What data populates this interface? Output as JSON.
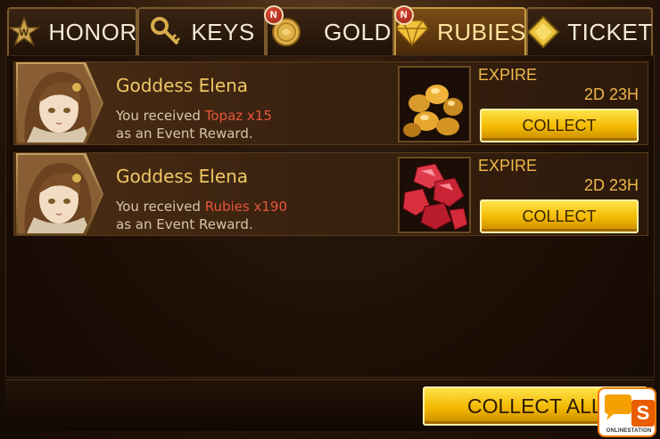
{
  "tabs": [
    {
      "label": "HONOR",
      "icon": "star-wreath-icon",
      "active": false,
      "badge": ""
    },
    {
      "label": "KEYS",
      "icon": "key-icon",
      "active": false,
      "badge": ""
    },
    {
      "label": "GOLD",
      "icon": "gold-coin-icon",
      "active": false,
      "badge": "N"
    },
    {
      "label": "RUBIES",
      "icon": "ruby-gem-icon",
      "active": true,
      "badge": "N"
    },
    {
      "label": "TICKET",
      "icon": "ticket-diamond-icon",
      "active": false,
      "badge": ""
    }
  ],
  "mails": [
    {
      "sender": "Goddess Elena",
      "prefix": "You received",
      "item": "Topaz x15",
      "suffix": "as an Event Reward.",
      "item_icon": "topaz-pile-icon",
      "expire_label": "EXPIRE",
      "expire_time": "2D 23H",
      "collect_label": "COLLECT"
    },
    {
      "sender": "Goddess Elena",
      "prefix": "You received",
      "item": "Rubies x190",
      "suffix": "as an Event Reward.",
      "item_icon": "rubies-pile-icon",
      "expire_label": "EXPIRE",
      "expire_time": "2D 23H",
      "collect_label": "COLLECT"
    }
  ],
  "collect_all_label": "COLLECT ALL",
  "watermark": {
    "letter": "S",
    "text": "ONLINESTATION"
  },
  "colors": {
    "accent_gold": "#f2b800",
    "item_red": "#e8553c",
    "sender_gold": "#f0c864"
  }
}
